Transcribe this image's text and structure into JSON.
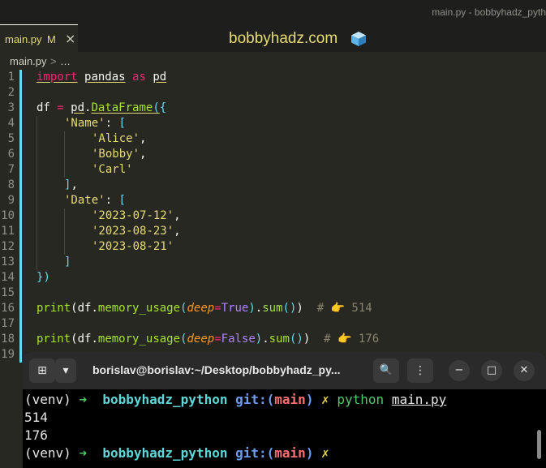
{
  "window": {
    "title": "main.py - bobbyhadz_pyth"
  },
  "tab": {
    "filename": "main.py",
    "modified": "M",
    "close": "×"
  },
  "brand": {
    "text": "bobbyhadz.com"
  },
  "breadcrumb": {
    "file": "main.py",
    "sep": ">",
    "more": "…"
  },
  "editor": {
    "line_numbers": [
      "1",
      "2",
      "3",
      "4",
      "5",
      "6",
      "7",
      "8",
      "9",
      "10",
      "11",
      "12",
      "13",
      "14",
      "15",
      "16",
      "17",
      "18",
      "19"
    ],
    "lines": {
      "l1": {
        "kw_import": "import",
        "mod": "pandas",
        "kw_as": "as",
        "alias": "pd"
      },
      "l3": {
        "var": "df",
        "eq": "=",
        "mod": "pd",
        "dot": ".",
        "cls": "DataFrame",
        "paren": "(",
        "brace": "{"
      },
      "l4": {
        "key": "'Name'",
        "colon": ":",
        "bracket": "["
      },
      "l5": {
        "val": "'Alice'",
        "comma": ","
      },
      "l6": {
        "val": "'Bobby'",
        "comma": ","
      },
      "l7": {
        "val": "'Carl'"
      },
      "l8": {
        "bracket": "]",
        "comma": ","
      },
      "l9": {
        "key": "'Date'",
        "colon": ":",
        "bracket": "["
      },
      "l10": {
        "val": "'2023-07-12'",
        "comma": ","
      },
      "l11": {
        "val": "'2023-08-23'",
        "comma": ","
      },
      "l12": {
        "val": "'2023-08-21'"
      },
      "l13": {
        "bracket": "]"
      },
      "l14": {
        "brace": "}",
        "paren": ")"
      },
      "l16": {
        "print": "print",
        "p1": "(",
        "df": "df",
        "dot1": ".",
        "method": "memory_usage",
        "p2": "(",
        "arg": "deep",
        "eq": "=",
        "value": "True",
        "p3": ")",
        "dot2": ".",
        "sum": "sum",
        "p4": "()",
        "p5": ")",
        "comment": "# 👉 514"
      },
      "l18": {
        "print": "print",
        "p1": "(",
        "df": "df",
        "dot1": ".",
        "method": "memory_usage",
        "p2": "(",
        "arg": "deep",
        "eq": "=",
        "value": "False",
        "p3": ")",
        "dot2": ".",
        "sum": "sum",
        "p4": "()",
        "p5": ")",
        "comment": "# 👉 176"
      }
    }
  },
  "terminal": {
    "title": "borislav@borislav:~/Desktop/bobbyhadz_py...",
    "new_tab_icon": "⊞",
    "dropdown_icon": "▾",
    "search_icon": "🔍",
    "menu_icon": "⋮",
    "minimize_icon": "−",
    "maximize_icon": "□",
    "close_icon": "✕",
    "prompt": {
      "venv": "(venv)",
      "arrow": "➜",
      "dir": "bobbyhadz_python",
      "git": "git:(",
      "branch": "main",
      "git_close": ")",
      "x": "✗"
    },
    "command": {
      "cmd": "python",
      "arg": "main.py"
    },
    "output": [
      "514",
      "176"
    ]
  },
  "colors": {
    "editor_bg": "#272822",
    "string": "#e6db74",
    "keyword": "#f92672",
    "function": "#a6e22e",
    "bracket": "#66d9ef",
    "constant": "#ae81ff",
    "terminal_bg": "#000000"
  }
}
